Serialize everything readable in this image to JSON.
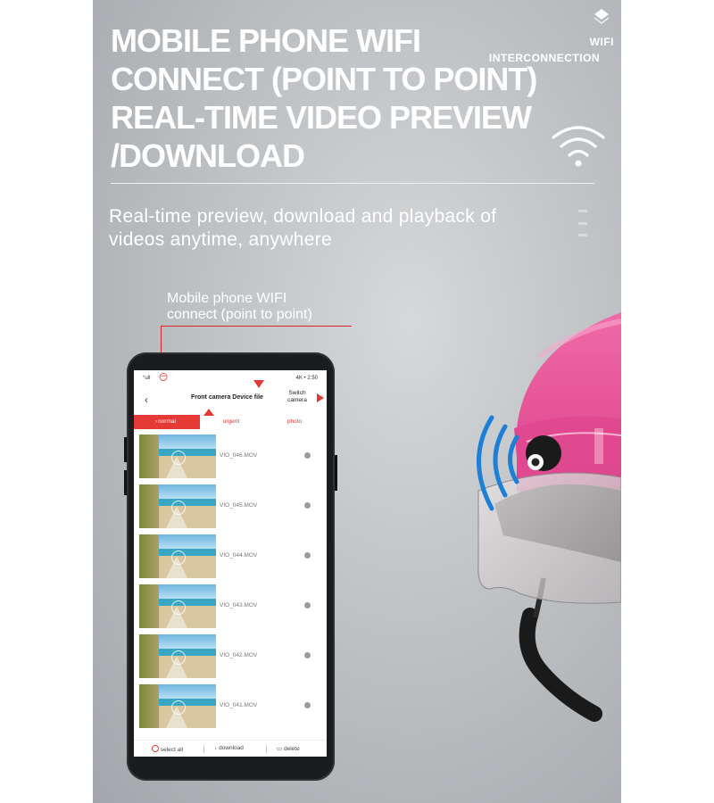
{
  "headline": {
    "lines": [
      "MOBILE PHONE WIFI",
      "CONNECT (POINT TO POINT)",
      "REAL-TIME VIDEO PREVIEW",
      "/DOWNLOAD"
    ]
  },
  "badge": {
    "line1": "WIFI",
    "line2": "INTERCONNECTION",
    "icon": "diamond-icon"
  },
  "wifi_icon": "wifi-icon",
  "subtitle": {
    "line1": "Real-time preview, download and playback of",
    "line2": "videos anytime, anywhere"
  },
  "callout": {
    "line1": "Mobile phone WIFI",
    "line2": "connect (point to point)"
  },
  "phone": {
    "status_left": "°ull",
    "status_right": "4K • 2:50",
    "app_title": "Front camera Device file",
    "switch_line1": "Switch",
    "switch_line2": "camera",
    "tabs": [
      {
        "label": "normal",
        "active": true
      },
      {
        "label": "urgent",
        "active": false
      },
      {
        "label": "photo",
        "active": false
      }
    ],
    "files": [
      "VIO_046.MOV",
      "VIO_045.MOV",
      "VIO_044.MOV",
      "VIO_043.MOV",
      "VIO_042.MOV",
      "VIO_041.MOV"
    ],
    "bottom": {
      "select_all": "select all",
      "download": "download",
      "delete": "delete"
    }
  },
  "colors": {
    "accent_red": "#e53935",
    "helmet_pink": "#e8559a",
    "signal_blue": "#1e7fd6"
  }
}
